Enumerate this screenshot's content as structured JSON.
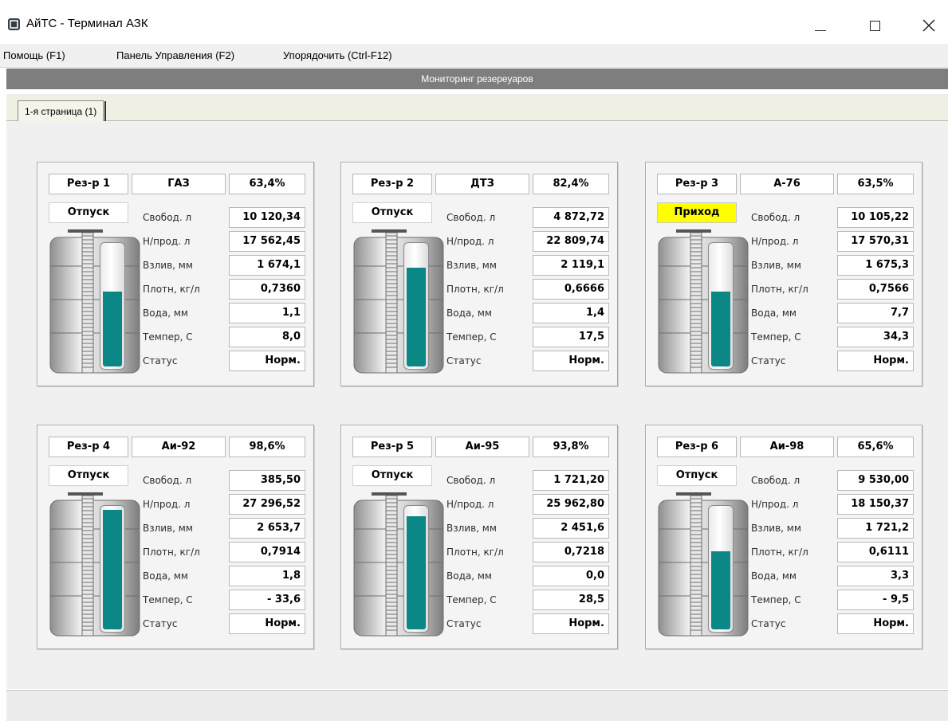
{
  "window": {
    "title": "АйТС - Терминал АЗК"
  },
  "menu": {
    "help": "Помощь (F1)",
    "control_panel": "Панель Управления (F2)",
    "arrange": "Упорядочить (Ctrl-F12)"
  },
  "section_title": "Мониторинг резереуаров",
  "tabs": [
    {
      "label": "1-я страница (1)"
    }
  ],
  "labels": {
    "free": "Свобод. л",
    "unsold": "Н/прод. л",
    "level": "Взлив, мм",
    "density": "Плотн, кг/л",
    "water": "Вода, мм",
    "temp": "Темпер, С",
    "status": "Статус"
  },
  "colors": {
    "fill": "#0b8785",
    "incoming_highlight": "#ffff00",
    "header_bar": "#7e7e7e"
  },
  "tanks": [
    {
      "name": "Рез-р 1",
      "fuel": "ГАЗ",
      "pct": "63,4%",
      "fill_pct": 63.4,
      "mode": "Отпуск",
      "free": "10 120,34",
      "unsold": "17 562,45",
      "level": "1 674,1",
      "density": "0,7360",
      "water": "1,1",
      "temp": "8,0",
      "status": "Норм."
    },
    {
      "name": "Рез-р 2",
      "fuel": "ДТЗ",
      "pct": "82,4%",
      "fill_pct": 82.4,
      "mode": "Отпуск",
      "free": "4 872,72",
      "unsold": "22 809,74",
      "level": "2 119,1",
      "density": "0,6666",
      "water": "1,4",
      "temp": "17,5",
      "status": "Норм."
    },
    {
      "name": "Рез-р 3",
      "fuel": "А-76",
      "pct": "63,5%",
      "fill_pct": 63.5,
      "mode": "Приход",
      "free": "10 105,22",
      "unsold": "17 570,31",
      "level": "1 675,3",
      "density": "0,7566",
      "water": "7,7",
      "temp": "34,3",
      "status": "Норм."
    },
    {
      "name": "Рез-р 4",
      "fuel": "Аи-92",
      "pct": "98,6%",
      "fill_pct": 98.6,
      "mode": "Отпуск",
      "free": "385,50",
      "unsold": "27 296,52",
      "level": "2 653,7",
      "density": "0,7914",
      "water": "1,8",
      "temp": "- 33,6",
      "status": "Норм."
    },
    {
      "name": "Рез-р 5",
      "fuel": "Аи-95",
      "pct": "93,8%",
      "fill_pct": 93.8,
      "mode": "Отпуск",
      "free": "1 721,20",
      "unsold": "25 962,80",
      "level": "2 451,6",
      "density": "0,7218",
      "water": "0,0",
      "temp": "28,5",
      "status": "Норм."
    },
    {
      "name": "Рез-р 6",
      "fuel": "Аи-98",
      "pct": "65,6%",
      "fill_pct": 65.6,
      "mode": "Отпуск",
      "free": "9 530,00",
      "unsold": "18 150,37",
      "level": "1 721,2",
      "density": "0,6111",
      "water": "3,3",
      "temp": "- 9,5",
      "status": "Норм."
    }
  ]
}
